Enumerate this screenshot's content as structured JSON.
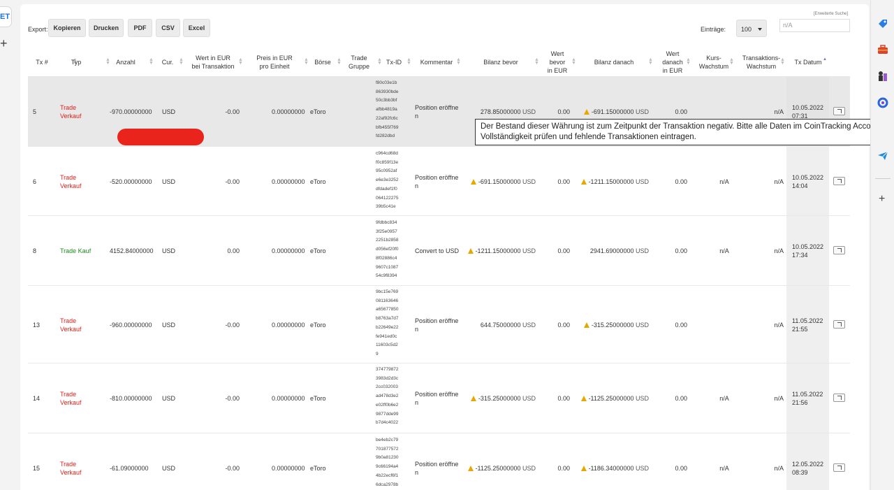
{
  "browser": {
    "left_tab_text": "ET"
  },
  "toolbar": {
    "export_label": "Export:",
    "buttons": [
      "Kopieren",
      "Drucken",
      "PDF",
      "CSV",
      "Excel"
    ],
    "entries_label": "Einträge:",
    "entries_value": "100",
    "advanced_search": "[Erweiterte Suche]",
    "search_placeholder": "n/A"
  },
  "columns": {
    "tx": "Tx #",
    "typ": "Typ",
    "anzahl": "Anzahl",
    "cur": "Cur.",
    "wert_eur": "Wert in EUR\nbei Transaktion",
    "preis_eur": "Preis in EUR\npro Einheit",
    "boerse": "Börse",
    "gruppe": "Trade\nGruppe",
    "txid": "Tx-ID",
    "kommentar": "Kommentar",
    "bilanz_bevor": "Bilanz bevor",
    "wert_bevor": "Wert\nbevor\nin EUR",
    "bilanz_danach": "Bilanz danach",
    "wert_danach": "Wert\ndanach\nin EUR",
    "kurs": "Kurs-\nWachstum",
    "trans": "Transaktions-\nWachstum",
    "datum": "Tx Datum"
  },
  "rows": [
    {
      "tx": "5",
      "typ1": "Trade",
      "typ2": "Verkauf",
      "buy": false,
      "anzahl": "-970.00000000",
      "cur": "USD",
      "wert": "-0.00",
      "preis": "0.00000000",
      "boerse": "eToro",
      "txid": [
        "f80c03e1b",
        "863930bde",
        "50c3bb3bf",
        "afbb4819a",
        "22af92fc6c",
        "bfb455f769",
        "fd282dbd"
      ],
      "k1": "Position eröffne",
      "k2": "n",
      "bb_warn": false,
      "bb": "278.85000000",
      "bb_unit": "USD",
      "wb": "0.00",
      "bd_warn": true,
      "bd": "-691.15000000",
      "bd_unit": "USD",
      "wd": "0.00",
      "kurs": "",
      "trans": "n/A",
      "d1": "10.05.2022",
      "d2": "07:31"
    },
    {
      "tx": "6",
      "typ1": "Trade",
      "typ2": "Verkauf",
      "buy": false,
      "anzahl": "-520.00000000",
      "cur": "USD",
      "wert": "-0.00",
      "preis": "0.00000000",
      "boerse": "eToro",
      "txid": [
        "c964cd68d",
        "f0c859f13e",
        "95c0952af",
        "e6e3e3252",
        "dfdadef1f0",
        "064122275",
        "39b5c41e"
      ],
      "k1": "Position eröffne",
      "k2": "n",
      "bb_warn": true,
      "bb": "-691.15000000",
      "bb_unit": "USD",
      "wb": "0.00",
      "bd_warn": true,
      "bd": "-1211.15000000",
      "bd_unit": "USD",
      "wd": "0.00",
      "kurs": "n/A",
      "trans": "n/A",
      "d1": "10.05.2022",
      "d2": "14:04"
    },
    {
      "tx": "8",
      "typ1": "Trade Kauf",
      "typ2": "",
      "buy": true,
      "anzahl": "4152.84000000",
      "cur": "USD",
      "wert": "0.00",
      "preis": "0.00000000",
      "boerse": "eToro",
      "txid": [
        "9fdbbc834",
        "3f25e0957",
        "2251b2858",
        "d056ef20f0",
        "8f02886c4",
        "9607c1087",
        "54c9f8394"
      ],
      "k1": "Convert to USD",
      "k2": "",
      "bb_warn": true,
      "bb": "-1211.15000000",
      "bb_unit": "USD",
      "wb": "0.00",
      "bd_warn": false,
      "bd": "2941.69000000",
      "bd_unit": "USD",
      "wd": "0.00",
      "kurs": "n/A",
      "trans": "n/A",
      "d1": "10.05.2022",
      "d2": "17:34"
    },
    {
      "tx": "13",
      "typ1": "Trade",
      "typ2": "Verkauf",
      "buy": false,
      "anzahl": "-960.00000000",
      "cur": "USD",
      "wert": "-0.00",
      "preis": "0.00000000",
      "boerse": "eToro",
      "txid": [
        "9bc15e769",
        "081163646",
        "a65677850",
        "b8763a7d7",
        "b22649e22",
        "fe941ed0c",
        "11603c5d2",
        "9"
      ],
      "k1": "Position eröffne",
      "k2": "n",
      "bb_warn": false,
      "bb": "644.75000000",
      "bb_unit": "USD",
      "wb": "0.00",
      "bd_warn": true,
      "bd": "-315.25000000",
      "bd_unit": "USD",
      "wd": "0.00",
      "kurs": "",
      "trans": "n/A",
      "d1": "11.05.2022",
      "d2": "21:55"
    },
    {
      "tx": "14",
      "typ1": "Trade",
      "typ2": "Verkauf",
      "buy": false,
      "anzahl": "-810.00000000",
      "cur": "USD",
      "wert": "-0.00",
      "preis": "0.00000000",
      "boerse": "eToro",
      "txid": [
        "374779872",
        "3983d2d3c",
        "2cc032003",
        "ad478d3e2",
        "e02ff0b6e2",
        "9877dde99",
        "b7d4c4022"
      ],
      "k1": "Position eröffne",
      "k2": "n",
      "bb_warn": true,
      "bb": "-315.25000000",
      "bb_unit": "USD",
      "wb": "0.00",
      "bd_warn": true,
      "bd": "-1125.25000000",
      "bd_unit": "USD",
      "wd": "0.00",
      "kurs": "n/A",
      "trans": "n/A",
      "d1": "11.05.2022",
      "d2": "21:56"
    },
    {
      "tx": "15",
      "typ1": "Trade",
      "typ2": "Verkauf",
      "buy": false,
      "anzahl": "-61.09000000",
      "cur": "USD",
      "wert": "-0.00",
      "preis": "0.00000000",
      "boerse": "eToro",
      "txid": [
        "be4eb2c79",
        "701877572",
        "9b0a81230",
        "9c66194a4",
        "4b22ecf6f1",
        "6dca2978b"
      ],
      "k1": "Position eröffne",
      "k2": "n",
      "bb_warn": true,
      "bb": "-1125.25000000",
      "bb_unit": "USD",
      "wb": "0.00",
      "bd_warn": true,
      "bd": "-1186.34000000",
      "bd_unit": "USD",
      "wd": "0.00",
      "kurs": "n/A",
      "trans": "n/A",
      "d1": "12.05.2022",
      "d2": "08:39"
    }
  ],
  "tooltip": {
    "line1": "Der Bestand dieser Währung ist zum Zeitpunkt der Transaktion negativ. Bitte alle Daten im CoinTracking Account auf",
    "line2": "Vollständigkeit prüfen und fehlende Transaktionen eintragen."
  },
  "colors": {
    "sell": "#e0201a",
    "buy": "#1e8c1e",
    "warning": "#e6a800",
    "redaction": "#e8241c"
  },
  "sidebar_icons": [
    "tag-icon",
    "toolbox-icon",
    "chess-icon",
    "sync-icon",
    "send-icon",
    "add-icon"
  ]
}
